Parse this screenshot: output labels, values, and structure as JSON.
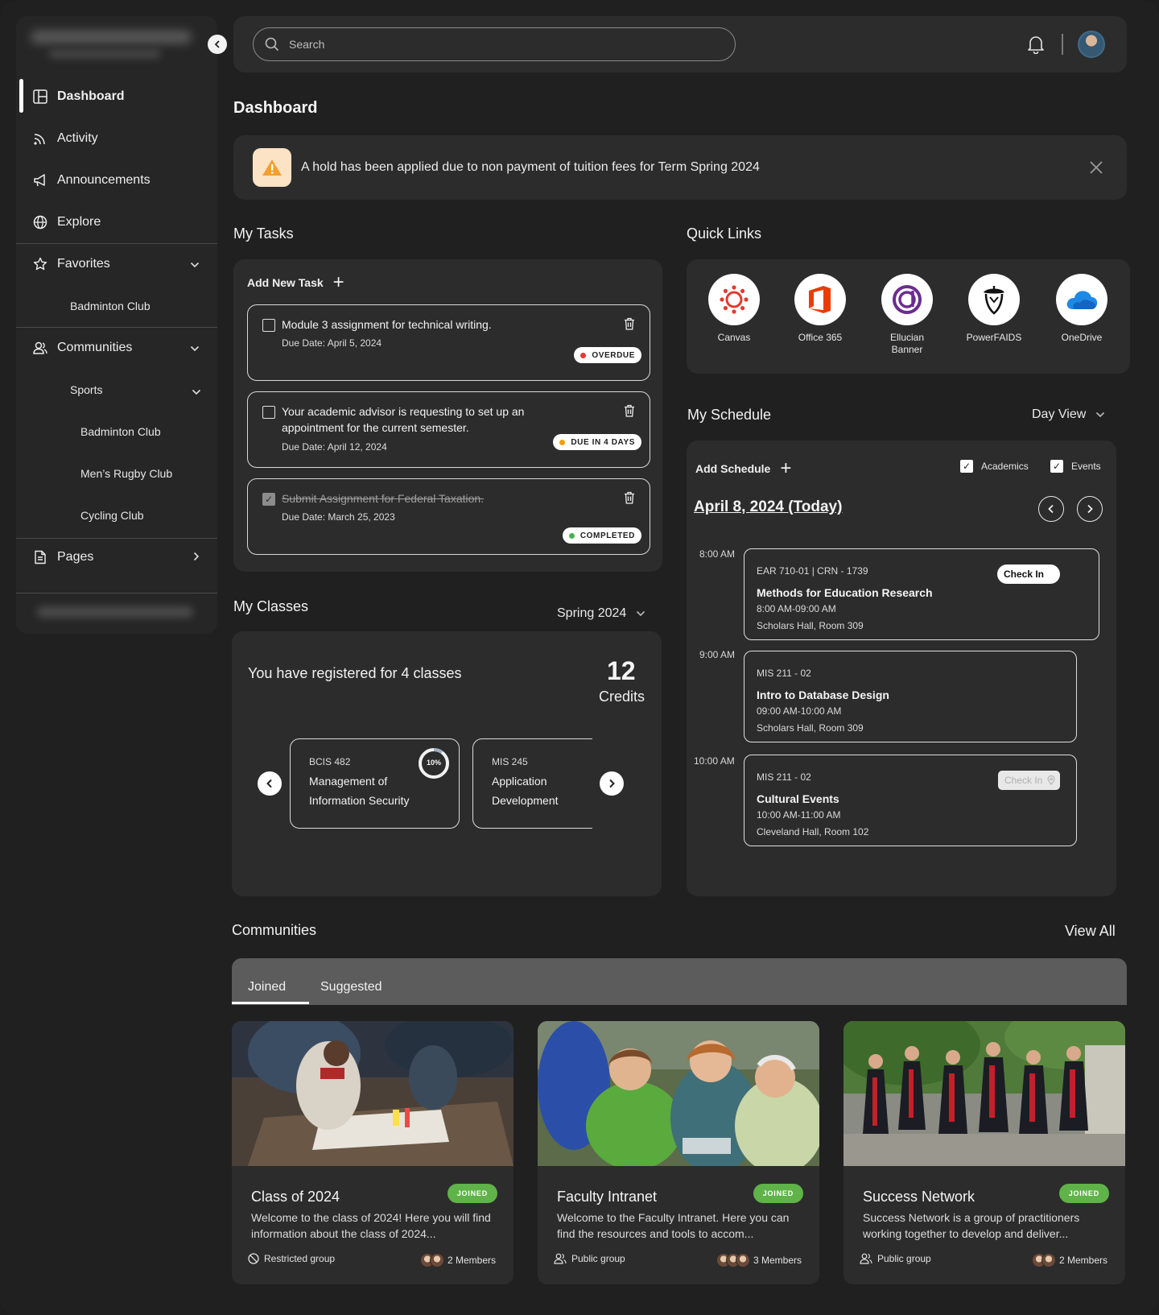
{
  "sidebar": {
    "collapse_icon": "chevron-left-icon",
    "items": [
      {
        "label": "Dashboard",
        "icon": "dashboard-icon"
      },
      {
        "label": "Activity",
        "icon": "rss-icon"
      },
      {
        "label": "Announcements",
        "icon": "megaphone-icon"
      },
      {
        "label": "Explore",
        "icon": "globe-icon"
      },
      {
        "label": "Favorites",
        "icon": "star-icon"
      },
      {
        "label": "Communities",
        "icon": "users-icon"
      },
      {
        "label": "Pages",
        "icon": "document-icon"
      }
    ],
    "favorites": [
      "Badminton Club"
    ],
    "communities_group": "Sports",
    "communities": [
      "Badminton Club",
      "Men’s Rugby Club",
      "Cycling Club"
    ]
  },
  "header": {
    "search_placeholder": "Search"
  },
  "page_title": "Dashboard",
  "alert": {
    "text": "A hold has been applied due to non payment of tuition fees for Term Spring 2024"
  },
  "tasks": {
    "title": "My Tasks",
    "add_label": "Add New Task",
    "items": [
      {
        "title": "Module 3 assignment for technical writing.",
        "due": "Due Date: April 5, 2024",
        "status": "OVERDUE",
        "status_color": "#e53935",
        "checked": false
      },
      {
        "title": "Your academic advisor is requesting to set up an appointment for the current semester.",
        "due": "Due Date: April 12, 2024",
        "status": "DUE IN 4 DAYS",
        "status_color": "#f59e0b",
        "checked": false
      },
      {
        "title": "Submit Assignment for Federal Taxation.",
        "due": "Due Date: March 25, 2023",
        "status": "COMPLETED",
        "status_color": "#4caf50",
        "checked": true
      }
    ]
  },
  "quick_links": {
    "title": "Quick Links",
    "items": [
      {
        "label": "Canvas",
        "icon": "canvas-icon"
      },
      {
        "label": "Office 365",
        "icon": "office-icon"
      },
      {
        "label": "Ellucian Banner",
        "icon": "ellucian-icon"
      },
      {
        "label": "PowerFAIDS",
        "icon": "acorn-icon"
      },
      {
        "label": "OneDrive",
        "icon": "cloud-icon"
      }
    ]
  },
  "schedule": {
    "title": "My Schedule",
    "view": "Day View",
    "add_label": "Add Schedule",
    "filters": [
      "Academics",
      "Events"
    ],
    "date": "April 8, 2024 (Today)",
    "times": [
      "8:00 AM",
      "9:00 AM",
      "10:00 AM"
    ],
    "events": [
      {
        "code": "EAR 710-01 | CRN - 1739",
        "title": "Methods for Education Research",
        "time": "8:00 AM-09:00 AM",
        "location": "Scholars Hall, Room 309",
        "checkin": "Check In"
      },
      {
        "code": "MIS 211 - 02",
        "title": "Intro to Database Design",
        "time": "09:00 AM-10:00 AM",
        "location": "Scholars Hall, Room 309"
      },
      {
        "code": "MIS 211 - 02",
        "title": "Cultural Events",
        "time": "10:00 AM-11:00 AM",
        "location": "Cleveland Hall, Room 102",
        "checkin": "Check In"
      }
    ]
  },
  "classes": {
    "title": "My Classes",
    "term": "Spring 2024",
    "summary": "You have registered for 4 classes",
    "credits_value": "12",
    "credits_label": "Credits",
    "cards": [
      {
        "code": "BCIS 482",
        "name": "Management of Information Security",
        "progress": "10%"
      },
      {
        "code": "MIS 245",
        "name": "Application Development"
      }
    ]
  },
  "communities": {
    "title": "Communities",
    "view_all": "View All",
    "tabs": [
      "Joined",
      "Suggested"
    ],
    "cards": [
      {
        "title": "Class of 2024",
        "badge": "JOINED",
        "desc": "Welcome to the class of 2024! Here you will find information about the class of 2024...",
        "type": "Restricted group",
        "members": "2 Members"
      },
      {
        "title": "Faculty Intranet",
        "badge": "JOINED",
        "desc": "Welcome to the Faculty Intranet. Here you can find the resources and tools to accom...",
        "type": "Public group",
        "members": "3 Members"
      },
      {
        "title": "Success Network",
        "badge": "JOINED",
        "desc": "Success Network is a group of practitioners working together to develop and deliver...",
        "type": "Public group",
        "members": "2 Members"
      }
    ]
  }
}
